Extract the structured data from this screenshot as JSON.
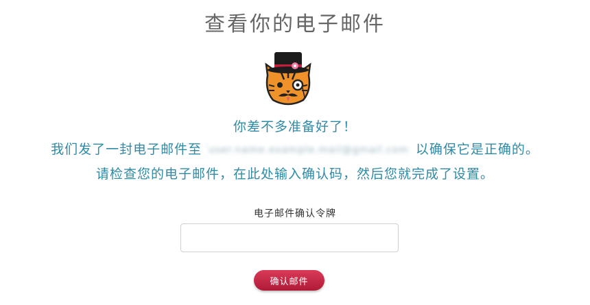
{
  "page": {
    "title": "查看你的电子邮件"
  },
  "messages": {
    "line1": "你差不多准备好了！",
    "line2_prefix": "我们发了一封电子邮件至",
    "line2_email": "user.name.example.mail@gmail.com",
    "line2_suffix": "以确保它是正确的。",
    "line3": "请检查您的电子邮件，在此处输入确认码，然后您就完成了设置。"
  },
  "form": {
    "token_label": "电子邮件确认令牌",
    "token_value": "",
    "confirm_button": "确认邮件"
  },
  "colors": {
    "accent_text": "#2f8aa6",
    "button": "#c4223f",
    "title": "#666666"
  },
  "icons": {
    "mascot": "cat-with-top-hat-icon"
  }
}
